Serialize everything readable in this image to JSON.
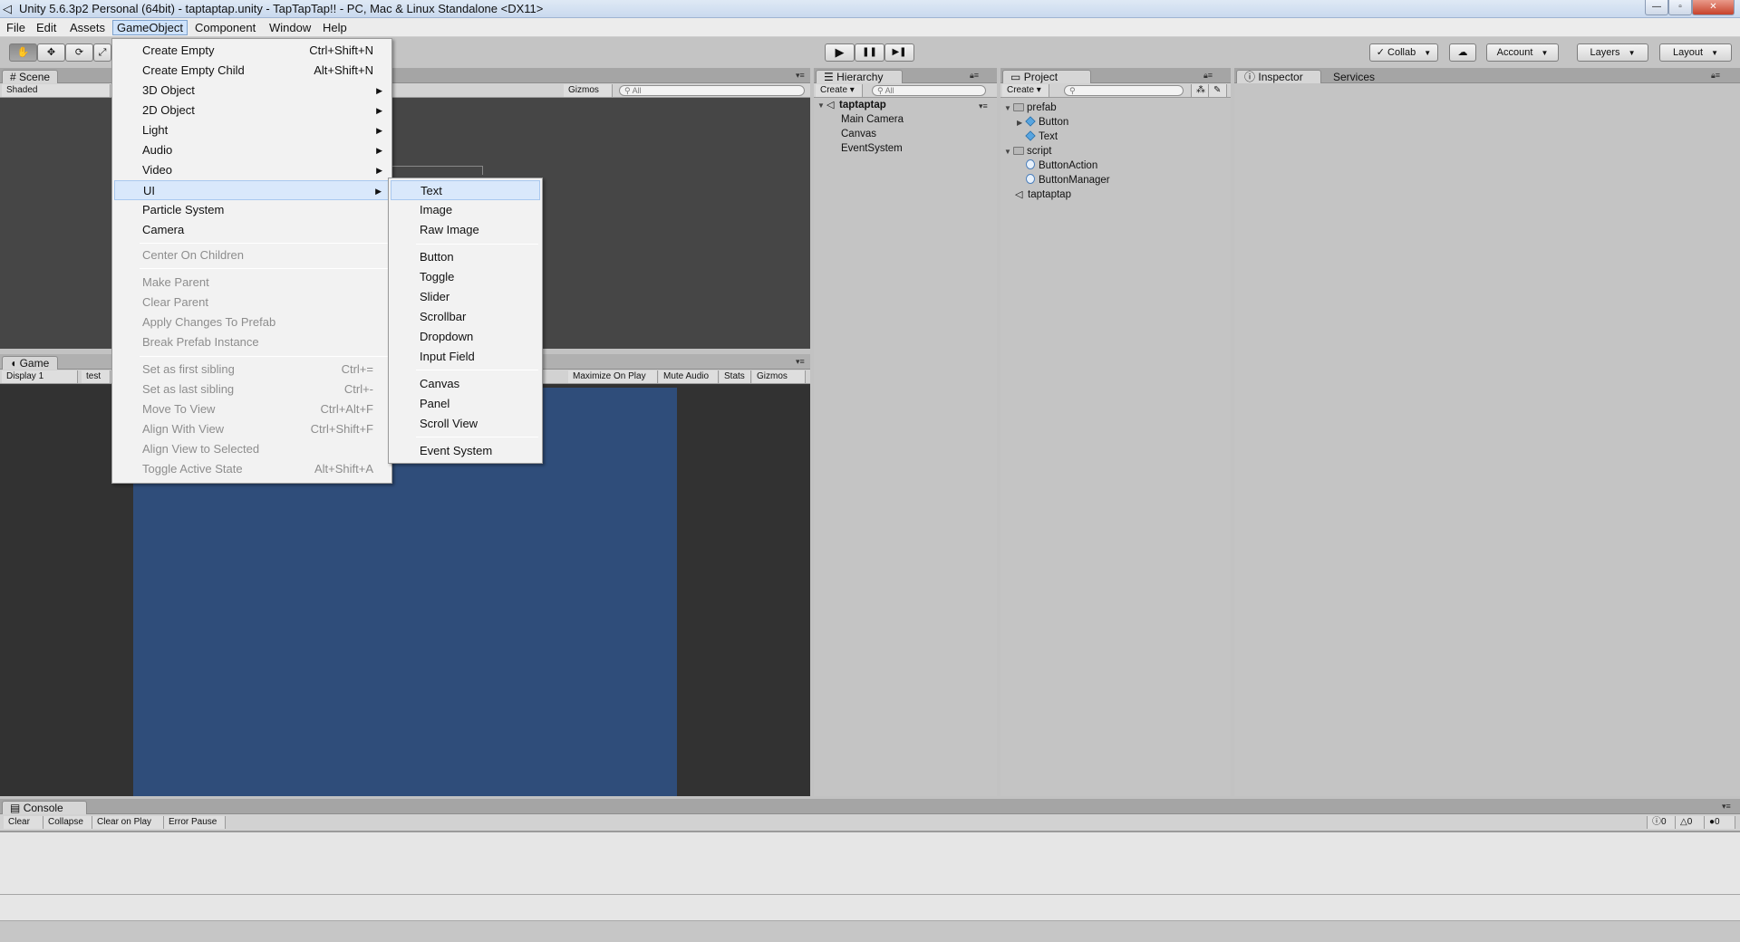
{
  "window": {
    "title": "Unity 5.6.3p2 Personal (64bit) - taptaptap.unity - TapTapTap!! - PC, Mac & Linux Standalone <DX11>",
    "buttons": {
      "minimize": "—",
      "maximize": "▫",
      "close": "✕"
    }
  },
  "menubar": [
    "File",
    "Edit",
    "Assets",
    "GameObject",
    "Component",
    "Window",
    "Help"
  ],
  "toolbar": {
    "tools": [
      "✋",
      "✥",
      "⟳",
      "⤢"
    ],
    "play": "▶",
    "pause": "❚❚",
    "step": "▶❚",
    "collab": "Collab",
    "account": "Account",
    "layers": "Layers",
    "layout": "Layout"
  },
  "scene": {
    "tab": "Scene",
    "shading": "Shaded",
    "gizmos": "Gizmos",
    "search_placeholder": "All"
  },
  "game": {
    "tab": "Game",
    "display": "Display 1",
    "resolution": "test",
    "buttons": [
      "Maximize On Play",
      "Mute Audio",
      "Stats",
      "Gizmos"
    ]
  },
  "hierarchy": {
    "tab": "Hierarchy",
    "create": "Create",
    "search_placeholder": "All",
    "scene": "taptaptap",
    "items": [
      "Main Camera",
      "Canvas",
      "EventSystem"
    ]
  },
  "project": {
    "tab": "Project",
    "create": "Create",
    "tree": {
      "folder1": "prefab",
      "folder1_items": [
        "Button",
        "Text"
      ],
      "folder2": "script",
      "folder2_items": [
        "ButtonAction",
        "ButtonManager"
      ],
      "scene": "taptaptap"
    }
  },
  "inspector": {
    "tab": "Inspector",
    "services": "Services"
  },
  "console": {
    "tab": "Console",
    "buttons": [
      "Clear",
      "Collapse",
      "Clear on Play",
      "Error Pause"
    ],
    "counts": {
      "info": "0",
      "warn": "0",
      "error": "0"
    }
  },
  "gameobject_menu": [
    {
      "label": "Create Empty",
      "shortcut": "Ctrl+Shift+N"
    },
    {
      "label": "Create Empty Child",
      "shortcut": "Alt+Shift+N"
    },
    {
      "label": "3D Object",
      "arrow": "▶"
    },
    {
      "label": "2D Object",
      "arrow": "▶"
    },
    {
      "label": "Light",
      "arrow": "▶"
    },
    {
      "label": "Audio",
      "arrow": "▶"
    },
    {
      "label": "Video",
      "arrow": "▶"
    },
    {
      "label": "UI",
      "arrow": "▶"
    },
    {
      "label": "Particle System"
    },
    {
      "label": "Camera"
    },
    {
      "label": "Center On Children"
    },
    {
      "label": "Make Parent"
    },
    {
      "label": "Clear Parent"
    },
    {
      "label": "Apply Changes To Prefab"
    },
    {
      "label": "Break Prefab Instance"
    },
    {
      "label": "Set as first sibling",
      "shortcut": "Ctrl+="
    },
    {
      "label": "Set as last sibling",
      "shortcut": "Ctrl+-"
    },
    {
      "label": "Move To View",
      "shortcut": "Ctrl+Alt+F"
    },
    {
      "label": "Align With View",
      "shortcut": "Ctrl+Shift+F"
    },
    {
      "label": "Align View to Selected"
    },
    {
      "label": "Toggle Active State",
      "shortcut": "Alt+Shift+A"
    }
  ],
  "ui_submenu": [
    "Text",
    "Image",
    "Raw Image",
    "Button",
    "Toggle",
    "Slider",
    "Scrollbar",
    "Dropdown",
    "Input Field",
    "Canvas",
    "Panel",
    "Scroll View",
    "Event System"
  ],
  "colors": {
    "game_canvas": "#2f4d7a",
    "scene_bg": "#464646",
    "highlight": "#d9e8fb"
  }
}
